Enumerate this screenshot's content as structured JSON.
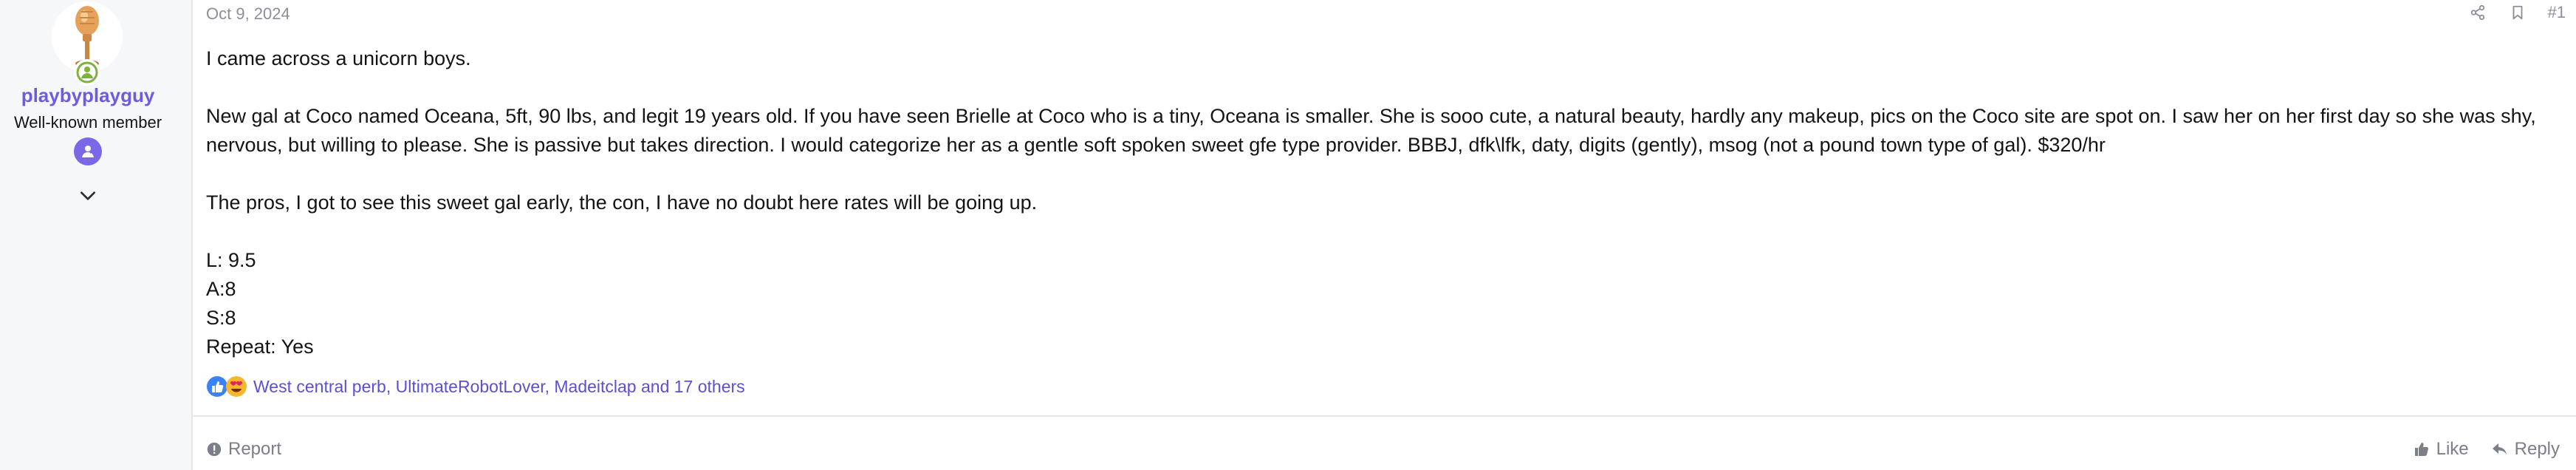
{
  "user": {
    "username": "playbyplayguy",
    "title": "Well-known member",
    "avatar_icon": "microphone-avatar",
    "online_icon": "online-person-icon",
    "rank_icon": "rank-badge-icon",
    "expand_icon": "chevron-down-icon"
  },
  "post": {
    "date": "Oct 9, 2024",
    "number": "#1",
    "body": {
      "line1": "I came across a unicorn boys.",
      "para2": "New gal at Coco named Oceana, 5ft, 90 lbs, and legit 19 years old. If you have seen Brielle at Coco who is a tiny, Oceana is smaller. She is sooo cute, a natural beauty, hardly any makeup, pics on the Coco site are spot on. I saw her on her first day so she was shy, nervous, but willing to please. She is passive but takes direction. I would categorize her as a gentle soft spoken sweet gfe type provider. BBBJ, dfk\\lfk, daty, digits (gently), msog (not a pound town type of gal). $320/hr",
      "para3": "The pros, I got to see this sweet gal early, the con, I have no doubt here rates will be going up.",
      "rating_l": "L: 9.5",
      "rating_a": "A:8",
      "rating_s": "S:8",
      "repeat": "Repeat: Yes"
    },
    "reactions": {
      "text": "West central perb, UltimateRobotLover, Madeitclap and 17 others",
      "icons": [
        "like-icon",
        "heart-eyes-icon"
      ]
    }
  },
  "actions": {
    "report": "Report",
    "like": "Like",
    "reply": "Reply"
  },
  "colors": {
    "accent": "#6d5ce0",
    "link": "#5c4fd6",
    "muted": "#8a8f99",
    "sidebar_bg": "#f5f7f9"
  }
}
